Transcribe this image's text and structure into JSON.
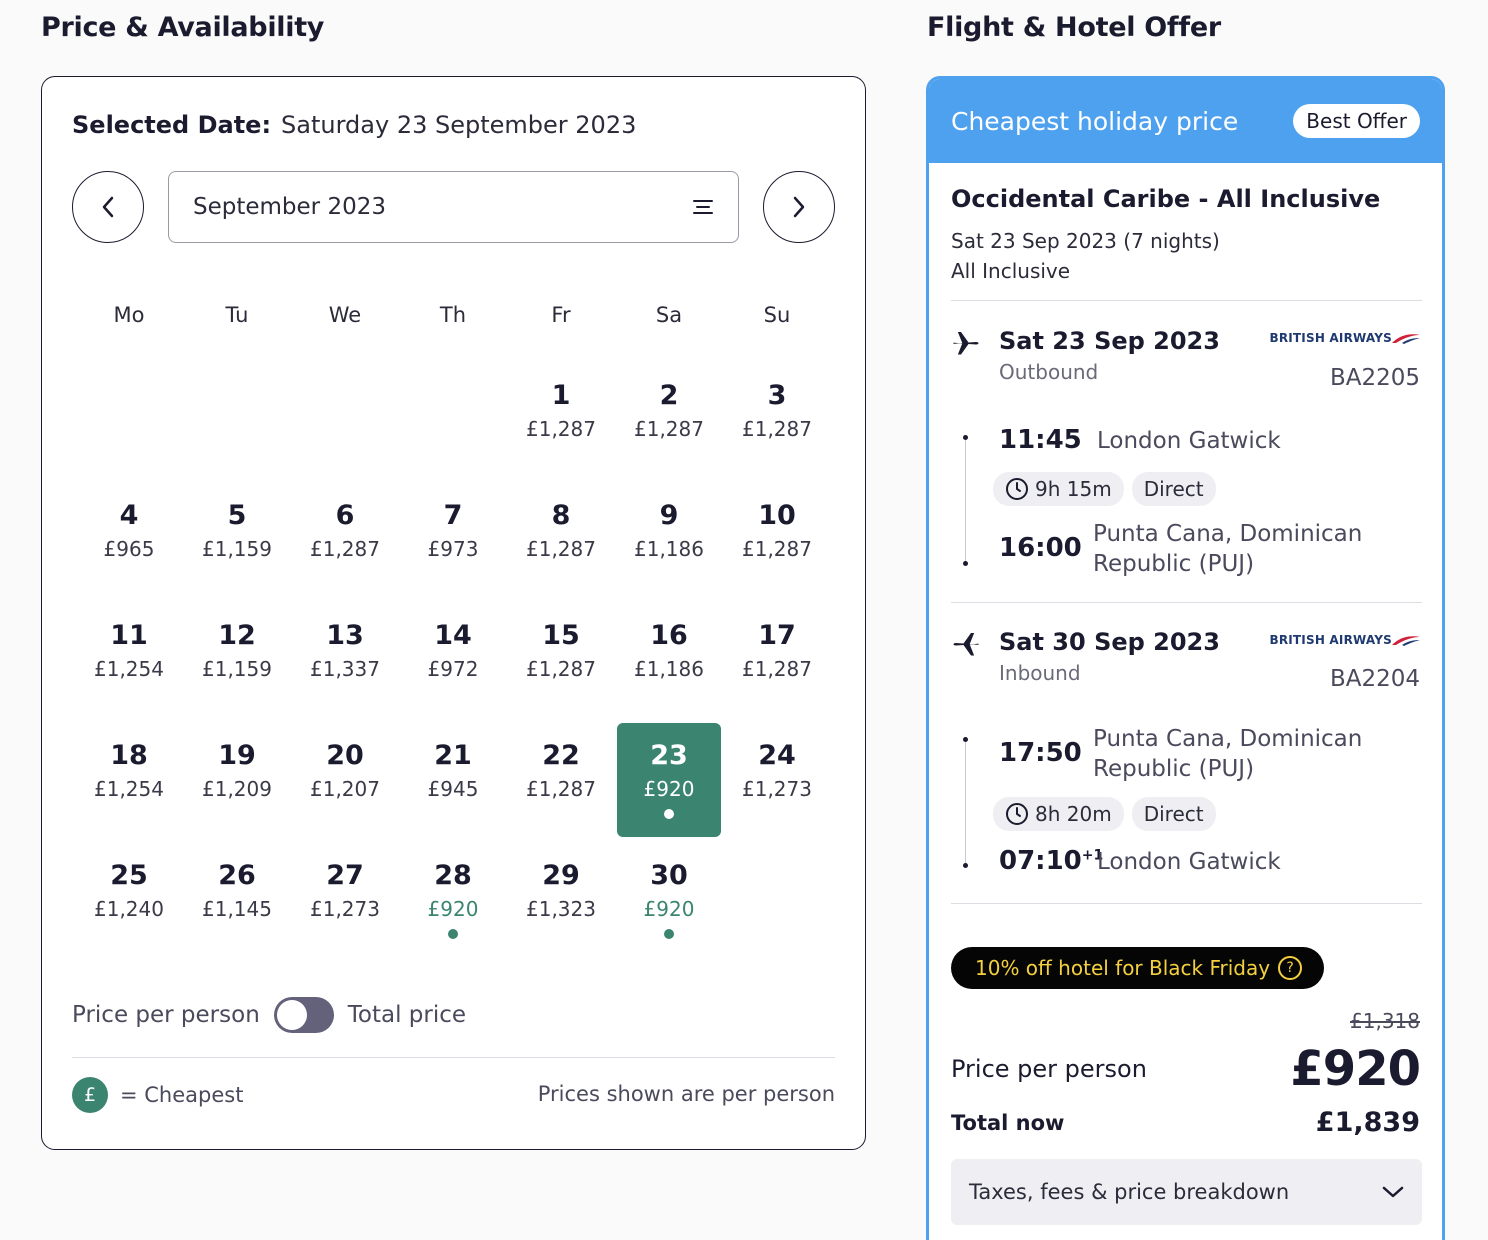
{
  "headings": {
    "left": "Price & Availability",
    "right": "Flight & Hotel Offer"
  },
  "calendar": {
    "selected_label": "Selected Date:",
    "selected_value": "Saturday 23 September 2023",
    "month": "September 2023",
    "weekdays": [
      "Mo",
      "Tu",
      "We",
      "Th",
      "Fr",
      "Sa",
      "Su"
    ],
    "days": [
      {
        "day": "",
        "price": ""
      },
      {
        "day": "",
        "price": ""
      },
      {
        "day": "",
        "price": ""
      },
      {
        "day": "",
        "price": ""
      },
      {
        "day": "1",
        "price": "£1,287"
      },
      {
        "day": "2",
        "price": "£1,287"
      },
      {
        "day": "3",
        "price": "£1,287"
      },
      {
        "day": "4",
        "price": "£965"
      },
      {
        "day": "5",
        "price": "£1,159"
      },
      {
        "day": "6",
        "price": "£1,287"
      },
      {
        "day": "7",
        "price": "£973"
      },
      {
        "day": "8",
        "price": "£1,287"
      },
      {
        "day": "9",
        "price": "£1,186"
      },
      {
        "day": "10",
        "price": "£1,287"
      },
      {
        "day": "11",
        "price": "£1,254"
      },
      {
        "day": "12",
        "price": "£1,159"
      },
      {
        "day": "13",
        "price": "£1,337"
      },
      {
        "day": "14",
        "price": "£972"
      },
      {
        "day": "15",
        "price": "£1,287"
      },
      {
        "day": "16",
        "price": "£1,186"
      },
      {
        "day": "17",
        "price": "£1,287"
      },
      {
        "day": "18",
        "price": "£1,254"
      },
      {
        "day": "19",
        "price": "£1,209"
      },
      {
        "day": "20",
        "price": "£1,207"
      },
      {
        "day": "21",
        "price": "£945"
      },
      {
        "day": "22",
        "price": "£1,287"
      },
      {
        "day": "23",
        "price": "£920",
        "cheapest": true,
        "selected": true
      },
      {
        "day": "24",
        "price": "£1,273"
      },
      {
        "day": "25",
        "price": "£1,240"
      },
      {
        "day": "26",
        "price": "£1,145"
      },
      {
        "day": "27",
        "price": "£1,273"
      },
      {
        "day": "28",
        "price": "£920",
        "cheapest": true
      },
      {
        "day": "29",
        "price": "£1,323"
      },
      {
        "day": "30",
        "price": "£920",
        "cheapest": true
      }
    ],
    "toggle_left": "Price per person",
    "toggle_right": "Total price",
    "toggle_on": false,
    "legend_symbol": "£",
    "legend_text": "= Cheapest",
    "note": "Prices shown are per person"
  },
  "offer": {
    "header": "Cheapest holiday price",
    "badge": "Best Offer",
    "hotel": "Occidental Caribe - All Inclusive",
    "dates": "Sat 23 Sep 2023 (7 nights)",
    "board": "All Inclusive",
    "airline_name": "BRITISH AIRWAYS",
    "outbound": {
      "date": "Sat 23 Sep 2023",
      "direction": "Outbound",
      "flight": "BA2205",
      "dep_time": "11:45",
      "dep_place": "London Gatwick",
      "duration": "9h 15m",
      "stops": "Direct",
      "arr_time": "16:00",
      "arr_place_1": "Punta Cana, Dominican",
      "arr_place_2": "Republic (PUJ)"
    },
    "inbound": {
      "date": "Sat 30 Sep 2023",
      "direction": "Inbound",
      "flight": "BA2204",
      "dep_time": "17:50",
      "dep_place_1": "Punta Cana, Dominican",
      "dep_place_2": "Republic (PUJ)",
      "duration": "8h 20m",
      "stops": "Direct",
      "arr_time": "07:10",
      "arr_day_offset": "+1",
      "arr_place": "London Gatwick"
    },
    "promo": "10% off hotel for Black Friday",
    "promo_icon": "?",
    "old_price": "£1,318",
    "ppp_label": "Price per person",
    "ppp_value": "£920",
    "total_label": "Total now",
    "total_value": "£1,839",
    "breakdown": "Taxes, fees & price breakdown"
  },
  "colors": {
    "accent_green": "#3b8570",
    "offer_blue": "#4ea1ee",
    "promo_yellow": "#f4d03f"
  }
}
